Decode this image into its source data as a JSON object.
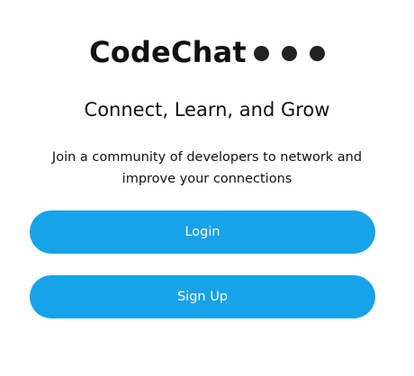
{
  "brand": {
    "name": "CodeChat",
    "dots_color": "#222222"
  },
  "tagline": "Connect, Learn, and Grow",
  "description": "Join a community of developers to network and improve your connections",
  "buttons": {
    "login_label": "Login",
    "signup_label": "Sign Up",
    "color": "#16A3EA"
  }
}
